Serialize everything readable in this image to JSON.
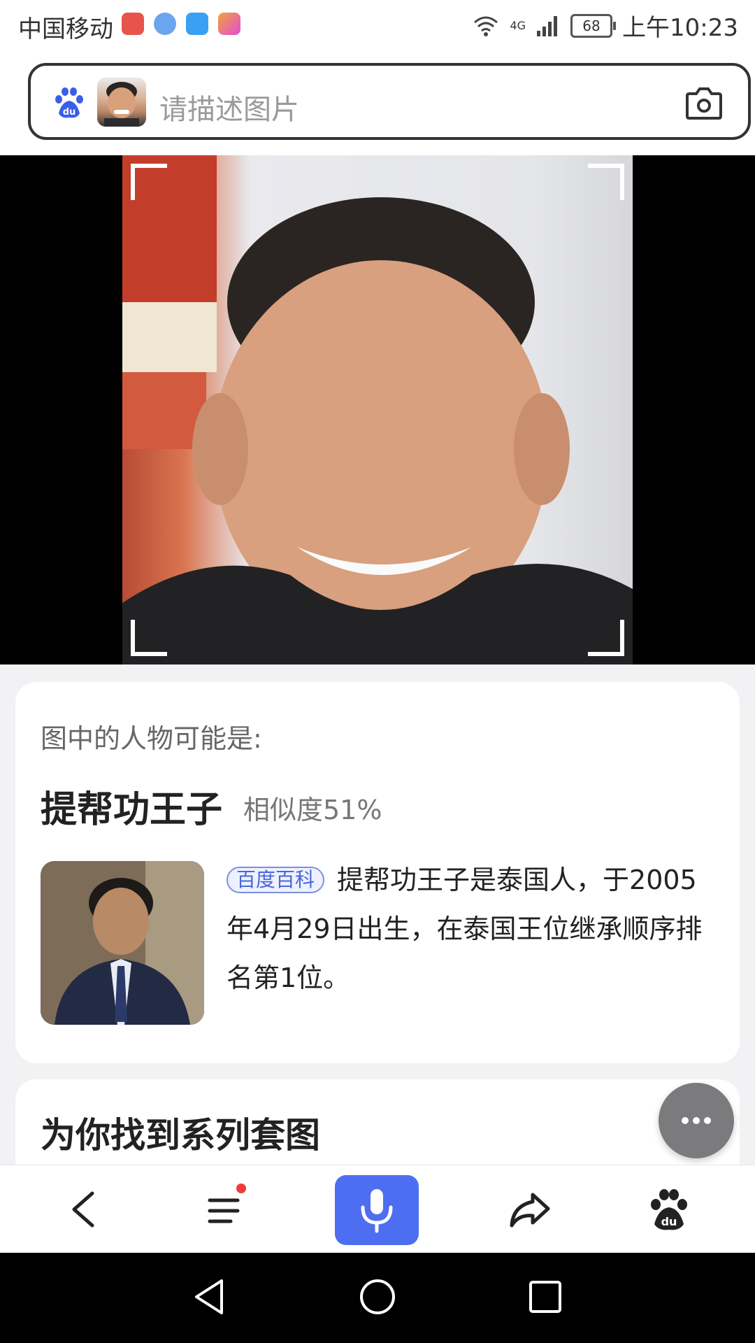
{
  "status_bar": {
    "carrier": "中国移动",
    "network": "4G",
    "battery": "68",
    "time": "上午10:23",
    "app_icons": [
      "huawei-app-icon",
      "browser-app-icon",
      "video-app-icon",
      "tool-app-icon"
    ]
  },
  "search": {
    "placeholder": "请描述图片",
    "logo_icon": "baidu-paw-icon",
    "camera_icon": "camera-icon"
  },
  "result": {
    "intro": "图中的人物可能是:",
    "name": "提帮功王子",
    "similarity": "相似度51%",
    "badge": "百度百科",
    "description": "提帮功王子是泰国人，于2005年4月29日出生，在泰国王位继承顺序排名第1位。"
  },
  "series": {
    "title": "为你找到系列套图"
  },
  "toolbar": {
    "icons": [
      "back-icon",
      "menu-icon",
      "microphone-icon",
      "share-icon",
      "baidu-paw-icon"
    ]
  },
  "colors": {
    "accent": "#4e6ef2",
    "badge_text": "#4a66d8",
    "notification_dot": "#f03c3c"
  }
}
